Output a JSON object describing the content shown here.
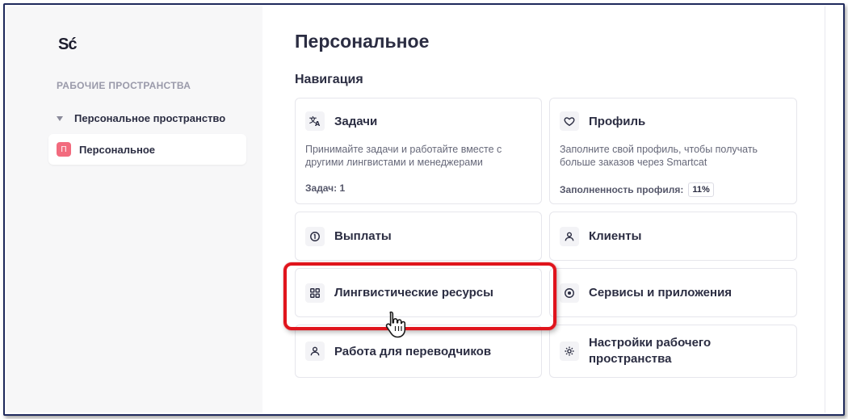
{
  "sidebar": {
    "logo": "Sć",
    "section_title": "РАБОЧИЕ ПРОСТРАНСТВА",
    "group_label": "Персональное пространство",
    "active_item": {
      "badge": "П",
      "label": "Персональное"
    }
  },
  "main": {
    "title": "Персональное",
    "nav_title": "Навигация",
    "cards": {
      "tasks": {
        "title": "Задачи",
        "icon": "translate-icon",
        "description": "Принимайте задачи и работайте вместе с другими лингвистами и менеджерами",
        "meta": "Задач: 1"
      },
      "profile": {
        "title": "Профиль",
        "icon": "heart-icon",
        "description": "Заполните свой профиль, чтобы получать больше заказов через Smartcat",
        "meta_label": "Заполненность профиля:",
        "meta_value": "11%"
      },
      "payouts": {
        "title": "Выплаты",
        "icon": "coin-icon"
      },
      "clients": {
        "title": "Клиенты",
        "icon": "person-icon"
      },
      "linguistic": {
        "title": "Лингвистические ресурсы",
        "icon": "grid-icon"
      },
      "services": {
        "title": "Сервисы и приложения",
        "icon": "target-icon"
      },
      "jobs": {
        "title": "Работа для переводчиков",
        "icon": "person-icon"
      },
      "settings": {
        "title": "Настройки рабочего пространства",
        "icon": "gear-icon"
      }
    }
  },
  "colors": {
    "highlight": "#e0141c",
    "badge": "#f26b7e",
    "sidebar_bg": "#f7f7f8"
  }
}
